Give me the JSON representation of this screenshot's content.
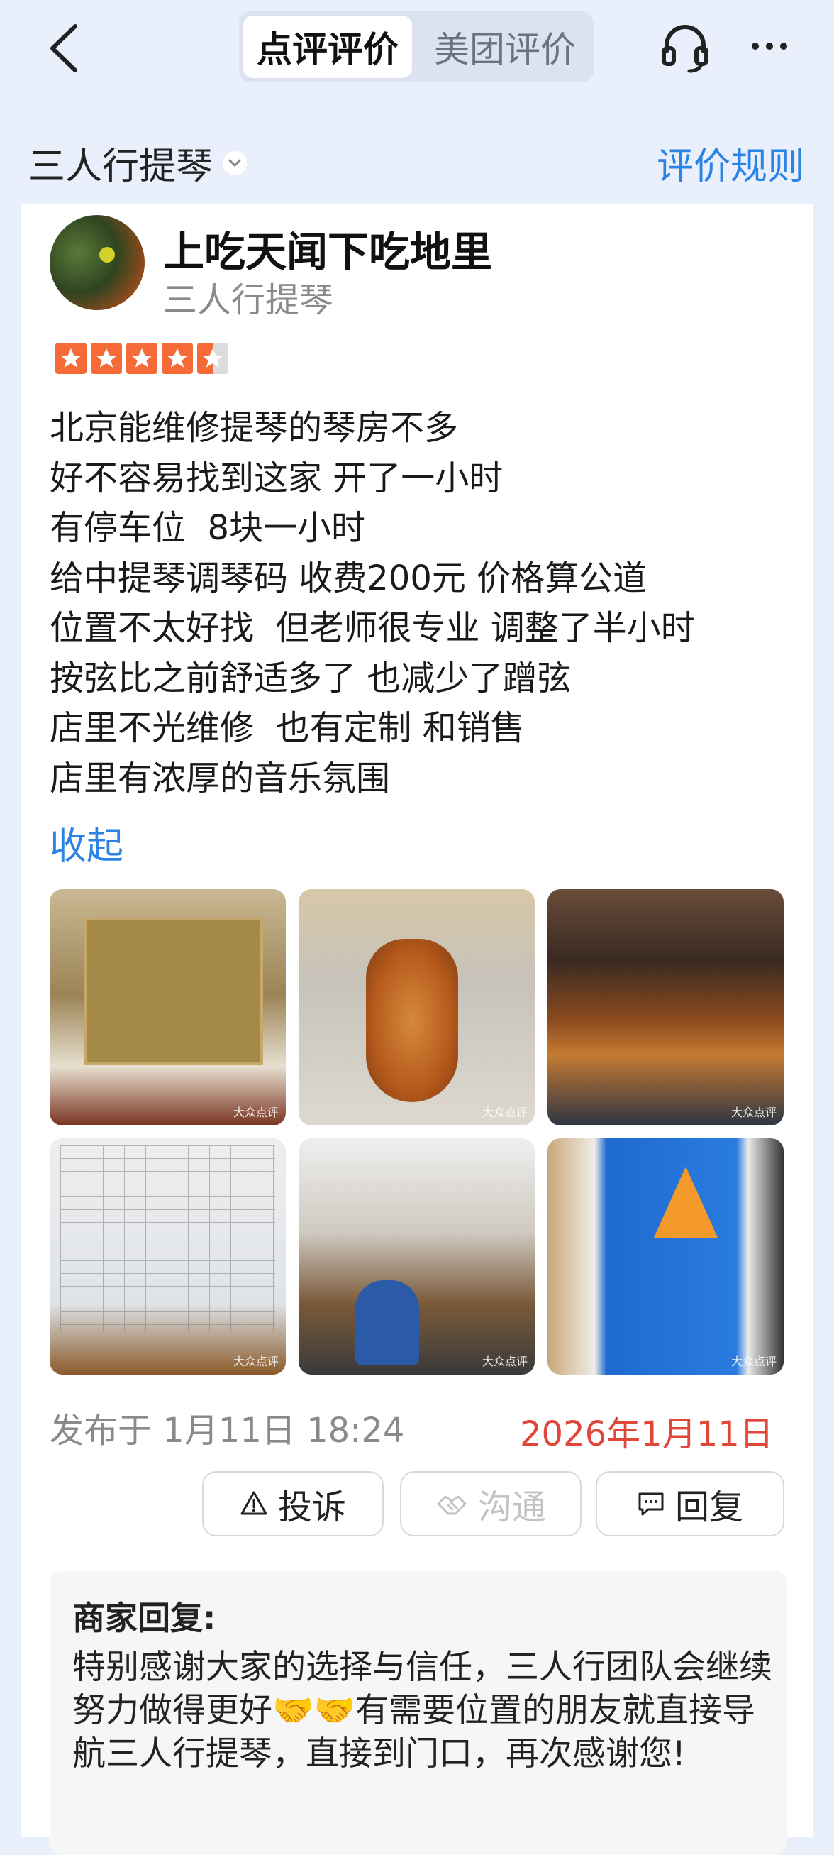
{
  "header": {
    "tabs": [
      {
        "label": "点评评价",
        "active": true
      },
      {
        "label": "美团评价",
        "active": false
      }
    ],
    "icons": [
      "back-icon",
      "headset-icon",
      "more-icon"
    ]
  },
  "filter": {
    "shop_name": "三人行提琴",
    "rules_label": "评价规则"
  },
  "review": {
    "user_name": "上吃天闻下吃地里",
    "user_shop": "三人行提琴",
    "rating": 4.5,
    "lines": [
      "北京能维修提琴的琴房不多",
      "好不容易找到这家 开了一小时",
      "有停车位  8块一小时",
      "给中提琴调琴码 收费200元 价格算公道",
      "位置不太好找  但老师很专业 调整了半小时",
      "按弦比之前舒适多了 也减少了蹭弦",
      "店里不光维修  也有定制 和销售",
      "店里有浓厚的音乐氛围"
    ],
    "collapse_label": "收起",
    "photo_watermark": "大众点评",
    "published": "发布于 1月11日 18:24",
    "date_highlight": "2026年1月11日"
  },
  "actions": {
    "complain": "投诉",
    "chat": "沟通",
    "reply": "回复"
  },
  "merchant_reply": {
    "title": "商家回复:",
    "text": "特别感谢大家的选择与信任，三人行团队会继续努力做得更好🤝🤝有需要位置的朋友就直接导航三人行提琴，直接到门口，再次感谢您!"
  },
  "colors": {
    "accent": "#2b83e6",
    "star": "#f56a37",
    "date_red": "#e0463a",
    "page_bg": "#eaf0fb"
  }
}
